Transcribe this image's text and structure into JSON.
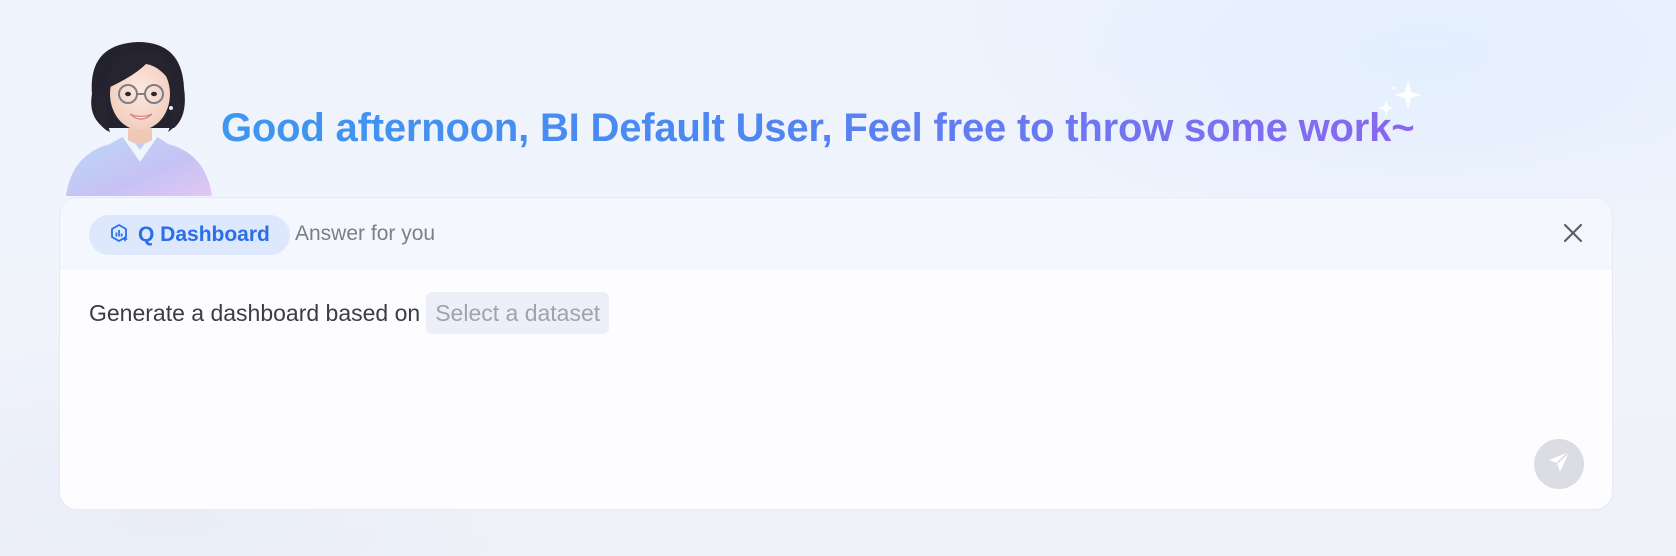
{
  "greeting": {
    "text": "Good afternoon, BI Default User, Feel free to throw some work~"
  },
  "assistant": {
    "avatar_icon": "assistant-avatar",
    "sparkle_icon": "sparkle-icon"
  },
  "card": {
    "mode_chip": {
      "icon": "dashboard-ai-icon",
      "label": "Q Dashboard"
    },
    "subtitle": "Answer for you",
    "close_icon": "close-icon",
    "prompt": {
      "prefix": "Generate a dashboard based on",
      "dataset_placeholder": "Select a dataset"
    },
    "send_icon": "send-icon"
  },
  "colors": {
    "accent": "#2a6fe8",
    "chip_bg": "#dde8fd",
    "gradient_start": "#3d97f0",
    "gradient_end": "#8a67ef",
    "send_bg": "#dcdde2"
  }
}
